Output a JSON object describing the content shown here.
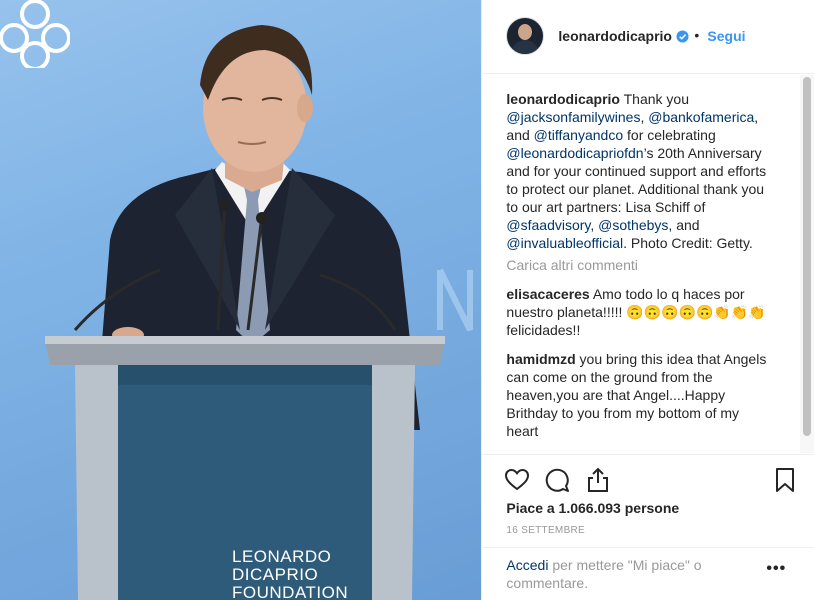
{
  "photo": {
    "logo_lines": [
      "LEONARDO",
      "DICAPRIO",
      "FOUNDATION"
    ]
  },
  "header": {
    "username": "leonardodicaprio",
    "separator": "•",
    "follow_label": "Segui"
  },
  "caption": {
    "username": "leonardodicaprio",
    "parts": [
      {
        "t": " Thank you ",
        "m": false
      },
      {
        "t": "@jacksonfamilywines",
        "m": true
      },
      {
        "t": ", ",
        "m": false
      },
      {
        "t": "@bankofamerica",
        "m": true
      },
      {
        "t": ", and ",
        "m": false
      },
      {
        "t": "@tiffanyandco",
        "m": true
      },
      {
        "t": " for celebrating ",
        "m": false
      },
      {
        "t": "@leonardodicapriofdn",
        "m": true
      },
      {
        "t": "’s 20th Anniversary and for your continued support and efforts to protect our planet. Additional thank you to our art partners: Lisa Schiff of ",
        "m": false
      },
      {
        "t": "@sfaadvisory",
        "m": true
      },
      {
        "t": ", ",
        "m": false
      },
      {
        "t": "@sothebys",
        "m": true
      },
      {
        "t": ", and ",
        "m": false
      },
      {
        "t": "@invaluableofficial",
        "m": true
      },
      {
        "t": ". Photo Credit: Getty.",
        "m": false
      }
    ]
  },
  "load_more_label": "Carica altri commenti",
  "comments": [
    {
      "username": "elisacaceres",
      "text": " Amo todo lo q haces por nuestro planeta!!!!! 🙃🙃🙃🙃🙃👏👏👏felicidades!!"
    },
    {
      "username": "hamidmzd",
      "text": " you bring this idea that Angels can come on the ground from the heaven,you are that Angel....Happy Brithday to you from my bottom of my heart"
    }
  ],
  "actions": {
    "like_icon": "heart-icon",
    "comment_icon": "comment-icon",
    "share_icon": "share-icon",
    "save_icon": "bookmark-icon"
  },
  "likes_text": "Piace a 1.066.093 persone",
  "date_text": "16 SETTEMBRE",
  "footer": {
    "login_link": "Accedi",
    "login_text": " per mettere \"Mi piace\" o commentare.",
    "more_label": "•••"
  },
  "colors": {
    "accent": "#3897f0",
    "mention": "#003569",
    "muted": "#999999",
    "verified": "#3897f0"
  }
}
